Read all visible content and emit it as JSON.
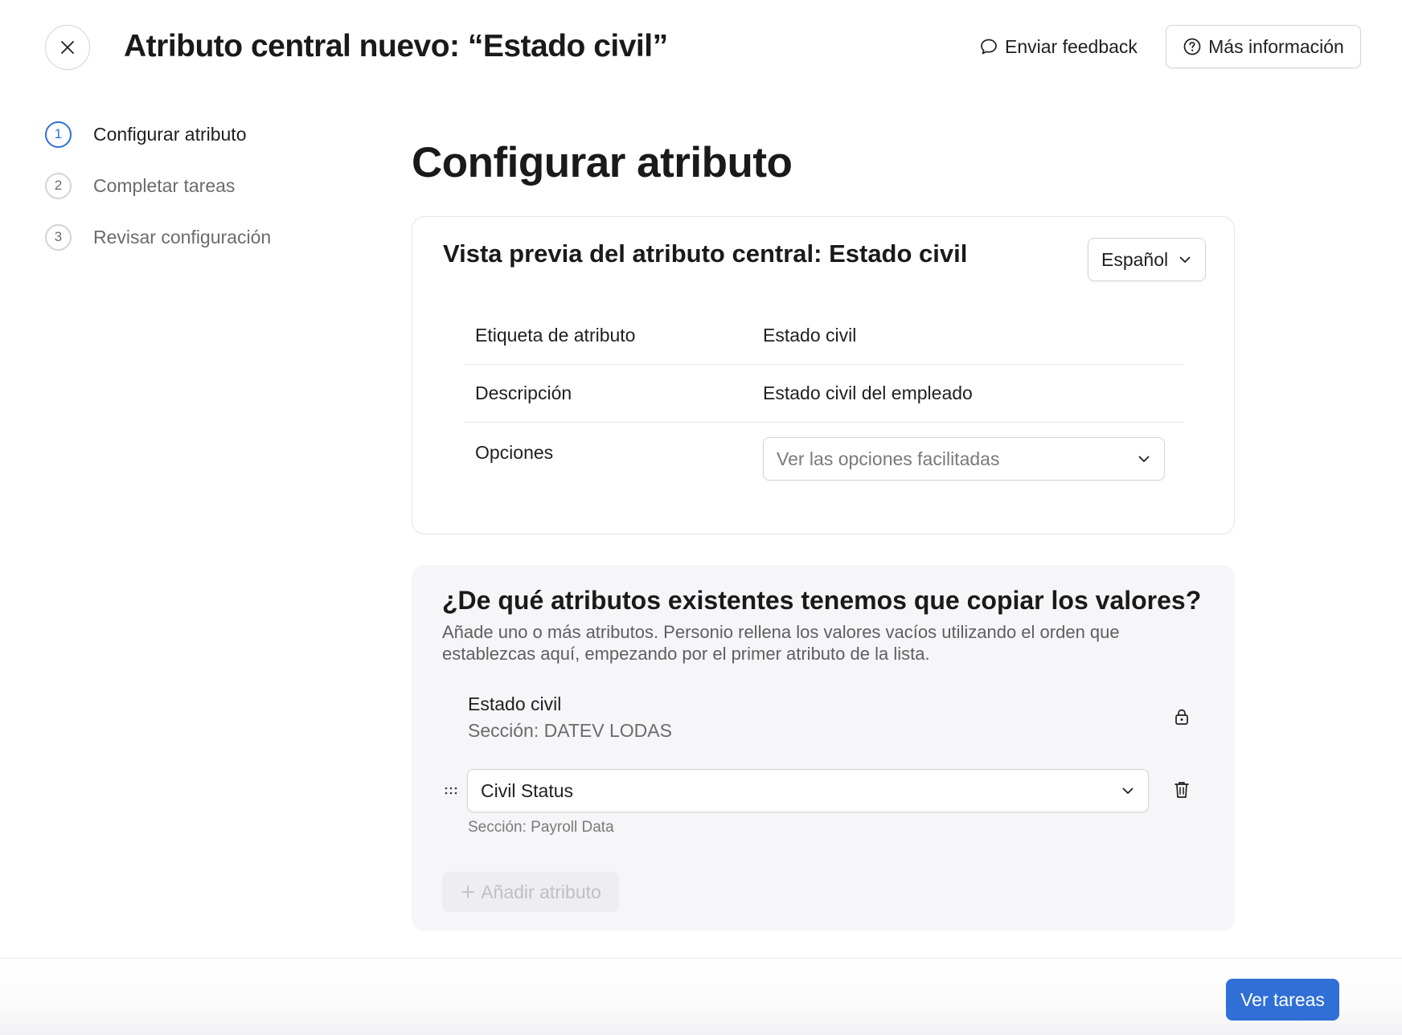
{
  "header": {
    "title": "Atributo central nuevo: “Estado civil”",
    "feedback_label": "Enviar feedback",
    "info_label": "Más información"
  },
  "stepper": {
    "steps": [
      {
        "number": "1",
        "label": "Configurar atributo",
        "active": true
      },
      {
        "number": "2",
        "label": "Completar tareas",
        "active": false
      },
      {
        "number": "3",
        "label": "Revisar configuración",
        "active": false
      }
    ]
  },
  "main": {
    "title": "Configurar atributo"
  },
  "preview": {
    "title": "Vista previa del atributo central: Estado civil",
    "language": "Español",
    "rows": [
      {
        "label": "Etiqueta de atributo",
        "value": "Estado civil"
      },
      {
        "label": "Descripción",
        "value": "Estado civil del empleado"
      },
      {
        "label": "Opciones",
        "placeholder": "Ver las opciones facilitadas"
      }
    ]
  },
  "copy": {
    "title": "¿De qué atributos existentes tenemos que copiar los valores?",
    "description": "Añade uno o más atributos. Personio rellena los valores vacíos utilizando el orden que establezcas aquí, empezando por el primer atributo de la lista.",
    "locked_attribute": {
      "name": "Estado civil",
      "section": "Sección: DATEV LODAS"
    },
    "selected_attribute": {
      "value": "Civil Status",
      "section": "Sección: Payroll Data"
    },
    "add_label": "Añadir atributo"
  },
  "footer": {
    "primary_label": "Ver tareas"
  },
  "colors": {
    "accent": "#2f6fd6",
    "card_bg": "#f6f6f8",
    "border": "#e4e4e7"
  },
  "icons": {
    "close": "close-icon",
    "feedback": "chat-bubble-icon",
    "info": "question-circle-icon",
    "chevron": "chevron-down-icon",
    "lock": "lock-icon",
    "drag": "drag-handle-icon",
    "trash": "trash-icon",
    "plus": "plus-icon"
  }
}
